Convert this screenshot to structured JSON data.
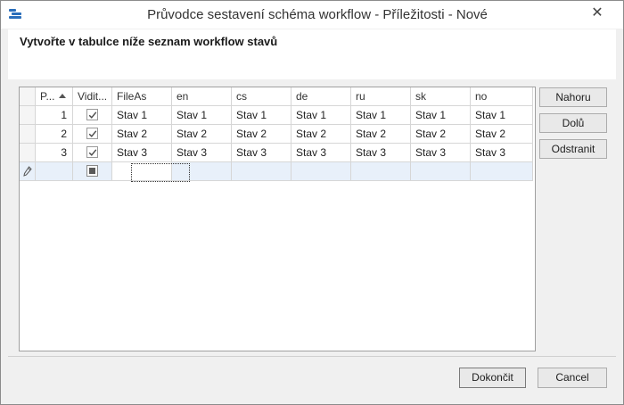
{
  "window": {
    "title": "Průvodce sestavení schéma workflow - Příležitosti - Nové",
    "close_glyph": "✕"
  },
  "instruction": "Vytvořte v tabulce níže seznam workflow stavů",
  "grid": {
    "columns": [
      "P...",
      "Vidit...",
      "FileAs",
      "en",
      "cs",
      "de",
      "ru",
      "sk",
      "no"
    ],
    "sorted_column": "P...",
    "rows": [
      {
        "pos": "1",
        "visible": true,
        "values": [
          "Stav 1",
          "Stav 1",
          "Stav 1",
          "Stav 1",
          "Stav 1",
          "Stav 1",
          "Stav 1"
        ]
      },
      {
        "pos": "2",
        "visible": true,
        "values": [
          "Stav 2",
          "Stav 2",
          "Stav 2",
          "Stav 2",
          "Stav 2",
          "Stav 2",
          "Stav 2"
        ]
      },
      {
        "pos": "3",
        "visible": true,
        "values": [
          "Stav 3",
          "Stav 3",
          "Stav 3",
          "Stav 3",
          "Stav 3",
          "Stav 3",
          "Stav 3"
        ]
      }
    ],
    "new_row_icon": "pencil-icon"
  },
  "side_buttons": {
    "up": "Nahoru",
    "down": "Dolů",
    "remove": "Odstranit"
  },
  "footer": {
    "finish": "Dokončit",
    "cancel": "Cancel"
  },
  "colors": {
    "accent_icon": "#2a6ebb",
    "new_row_bg": "#e8f0fa"
  }
}
